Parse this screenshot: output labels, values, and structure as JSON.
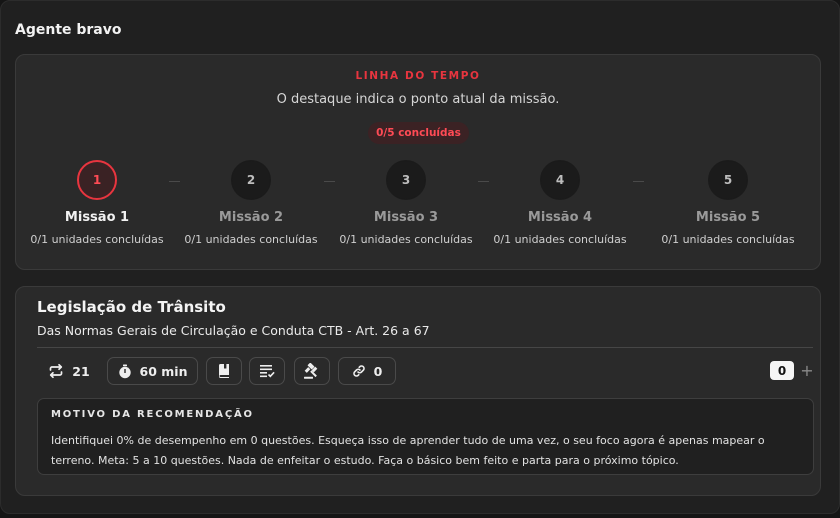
{
  "window": {
    "title": "Agente bravo"
  },
  "timeline": {
    "kicker": "LINHA DO TEMPO",
    "subtitle": "O destaque indica o ponto atual da missão.",
    "badge": "0/5 concluídas",
    "accent_color": "#e8353f",
    "steps": [
      {
        "number": "1",
        "title": "Missão 1",
        "sub": "0/1 unidades concluídas",
        "active": true
      },
      {
        "number": "2",
        "title": "Missão 2",
        "sub": "0/1 unidades concluídas",
        "active": false
      },
      {
        "number": "3",
        "title": "Missão 3",
        "sub": "0/1 unidades concluídas",
        "active": false
      },
      {
        "number": "4",
        "title": "Missão 4",
        "sub": "0/1 unidades concluídas",
        "active": false
      },
      {
        "number": "5",
        "title": "Missão 5",
        "sub": "0/1 unidades concluídas",
        "active": false
      }
    ]
  },
  "topic": {
    "title": "Legislação de Trânsito",
    "subtitle": "Das Normas Gerais de Circulação e Conduta CTB - Art. 26 a 67",
    "stats": {
      "repeat_icon": "repeat-icon",
      "repeat_count": "21",
      "timer_icon": "stopwatch-icon",
      "timer_label": "60 min",
      "book_icon": "book-icon",
      "list_icon": "checklist-icon",
      "gavel_icon": "gavel-icon",
      "link_icon": "link-icon",
      "link_count": "0",
      "counter_value": "0",
      "plus_label": "+"
    },
    "reason": {
      "title": "MOTIVO DA RECOMENDAÇÃO",
      "text": "Identifiquei 0% de desempenho em 0 questões. Esqueça isso de aprender tudo de uma vez, o seu foco agora é apenas mapear o terreno. Meta: 5 a 10 questões. Nada de enfeitar o estudo. Faça o básico bem feito e parta para o próximo tópico."
    }
  }
}
